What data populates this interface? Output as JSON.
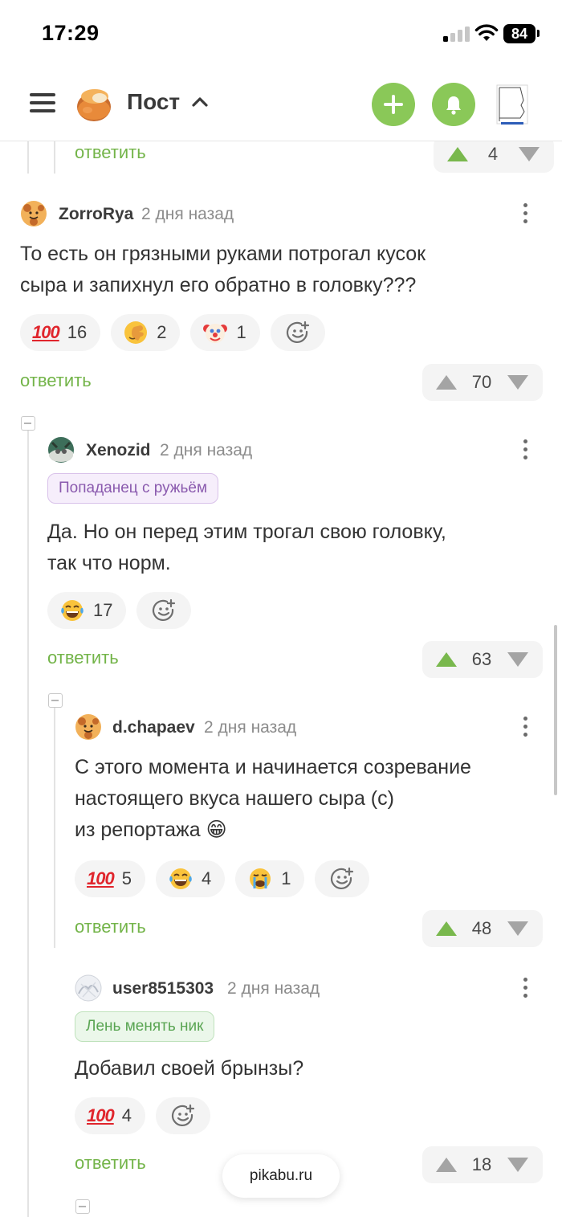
{
  "status_bar": {
    "time": "17:29",
    "battery": "84"
  },
  "header": {
    "title": "Пост"
  },
  "top_partial": {
    "reply": "ответить",
    "votes": "4"
  },
  "comments": [
    {
      "user": "ZorroRya",
      "time": "2 дня назад",
      "text": "То есть он грязными руками потрогал кусок\nсыра и запихнул его обратно в головку???",
      "reactions": [
        {
          "emoji": "hundred-points",
          "count": "16"
        },
        {
          "emoji": "face-palm",
          "count": "2"
        },
        {
          "emoji": "clown-face",
          "count": "1"
        }
      ],
      "reply": "ответить",
      "votes": "70"
    },
    {
      "user": "Xenozid",
      "time": "2 дня назад",
      "badge": "Попаданец с ружьём",
      "text": "Да. Но он перед этим трогал свою головку,\nтак что норм.",
      "reactions": [
        {
          "emoji": "tears-of-joy",
          "count": "17"
        }
      ],
      "reply": "ответить",
      "votes": "63"
    },
    {
      "user": "d.chapaev",
      "time": "2 дня назад",
      "text": "С этого момента и начинается созревание\nнастоящего вкуса нашего сыра (с)\nиз репортажа 😁",
      "reactions": [
        {
          "emoji": "hundred-points",
          "count": "5"
        },
        {
          "emoji": "tears-of-joy",
          "count": "4"
        },
        {
          "emoji": "crying-face",
          "count": "1"
        }
      ],
      "reply": "ответить",
      "votes": "48"
    },
    {
      "user": "user8515303",
      "time": "2 дня назад",
      "badge": "Лень менять ник",
      "text": "Добавил своей брынзы?",
      "reactions": [
        {
          "emoji": "hundred-points",
          "count": "4"
        }
      ],
      "reply": "ответить",
      "votes": "18"
    }
  ],
  "emoji_text": {
    "hundred": "100"
  },
  "toast": "pikabu.ru",
  "colors": {
    "accent": "#8ac858",
    "reply": "#73b449",
    "vote_up_active": "#79b84d"
  }
}
